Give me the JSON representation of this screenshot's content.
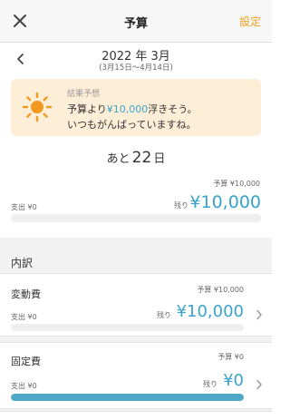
{
  "header": {
    "title": "予算",
    "settings_label": "設定",
    "accent_color": "#f0a020"
  },
  "period": {
    "month": "2022 年 3月",
    "range": "(3月15日〜4月14日)"
  },
  "forecast": {
    "label": "結果予想",
    "line1_prefix": "予算より",
    "line1_amount": "¥10,000",
    "line1_suffix": "浮きそう。",
    "line2": "いつもがんばっていますね。",
    "icon": "sun-icon"
  },
  "days_left": {
    "prefix": "あと",
    "number": "22",
    "unit": "日"
  },
  "summary": {
    "budget_label": "予算 ¥10,000",
    "spent_label": "支出 ¥0",
    "remaining_label": "残り",
    "remaining_amount": "¥10,000",
    "progress": 0
  },
  "breakdown": {
    "heading": "内訳",
    "items": [
      {
        "title": "変動費",
        "budget_label": "予算 ¥10,000",
        "spent_label": "支出 ¥0",
        "remaining_label": "残り",
        "remaining_amount": "¥10,000",
        "progress": 0
      },
      {
        "title": "固定費",
        "budget_label": "予算 ¥0",
        "spent_label": "支出 ¥0",
        "remaining_label": "残り",
        "remaining_amount": "¥0",
        "progress": 1
      }
    ]
  },
  "colors": {
    "remaining": "#3aa3c9",
    "bar_fill": "#4fa8c6",
    "forecast_bg": "#fdeed7"
  }
}
